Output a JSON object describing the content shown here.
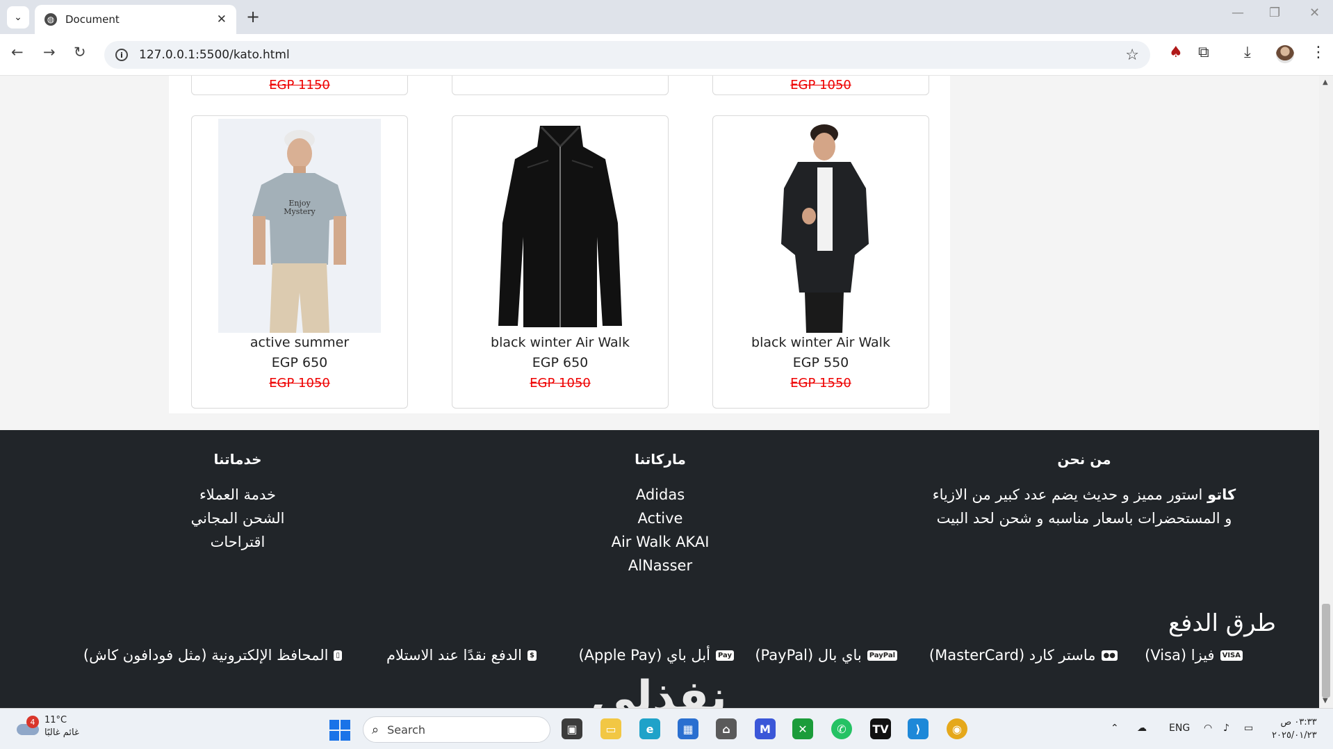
{
  "browser": {
    "tab_title": "Document",
    "url": "127.0.0.1:5500/kato.html"
  },
  "products_top": [
    {
      "old_price": "EGP 1150"
    },
    {
      "old_price": ""
    },
    {
      "old_price": "EGP 1050"
    }
  ],
  "products": [
    {
      "name": "active summer",
      "price": "EGP 650",
      "old_price": "EGP 1050",
      "image": "tshirt-model-image"
    },
    {
      "name": "black winter Air Walk",
      "price": "EGP 650",
      "old_price": "EGP 1050",
      "image": "leather-jacket-image"
    },
    {
      "name": "black winter Air Walk",
      "price": "EGP 550",
      "old_price": "EGP 1550",
      "image": "winter-jacket-model-image"
    }
  ],
  "footer": {
    "about": {
      "heading": "من نحن",
      "brand": "كاتو",
      "text_line1": "استور مميز و حديث يضم عدد كبير من الازياء",
      "text_line2": "و المستحضرات باسعار مناسبه و شحن لحد البيت"
    },
    "brands": {
      "heading": "ماركاتنا",
      "items": [
        "Adidas",
        "Active",
        "Air Walk AKAI",
        "AlNasser"
      ]
    },
    "services": {
      "heading": "خدماتنا",
      "items": [
        "خدمة العملاء",
        "الشحن المجاني",
        "اقتراحات"
      ]
    },
    "payment": {
      "title": "طرق الدفع",
      "methods": [
        {
          "label": "فيزا (Visa)",
          "icon": "visa-icon",
          "icon_text": "VISA"
        },
        {
          "label": "ماستر كارد (MasterCard)",
          "icon": "mastercard-icon",
          "icon_text": "●●"
        },
        {
          "label": "باي بال (PayPal)",
          "icon": "paypal-icon",
          "icon_text": "PayPal"
        },
        {
          "label": "أبل باي (Apple Pay)",
          "icon": "apple-pay-icon",
          "icon_text": "Pay"
        },
        {
          "label": "الدفع نقدًا عند الاستلام",
          "icon": "cash-icon",
          "icon_text": "$"
        },
        {
          "label": "المحافظ الإلكترونية (مثل فودافون كاش)",
          "icon": "mobile-wallet-icon",
          "icon_text": "▯"
        }
      ]
    },
    "watermark": "نفذلي"
  },
  "taskbar": {
    "weather_temp": "11°C",
    "weather_desc": "غائم غالبًا",
    "weather_badge": "4",
    "search_label": "Search",
    "language": "ENG",
    "time": "٠٣:٣٣ ص",
    "date": "٢٠٢٥/٠١/٢٣"
  }
}
